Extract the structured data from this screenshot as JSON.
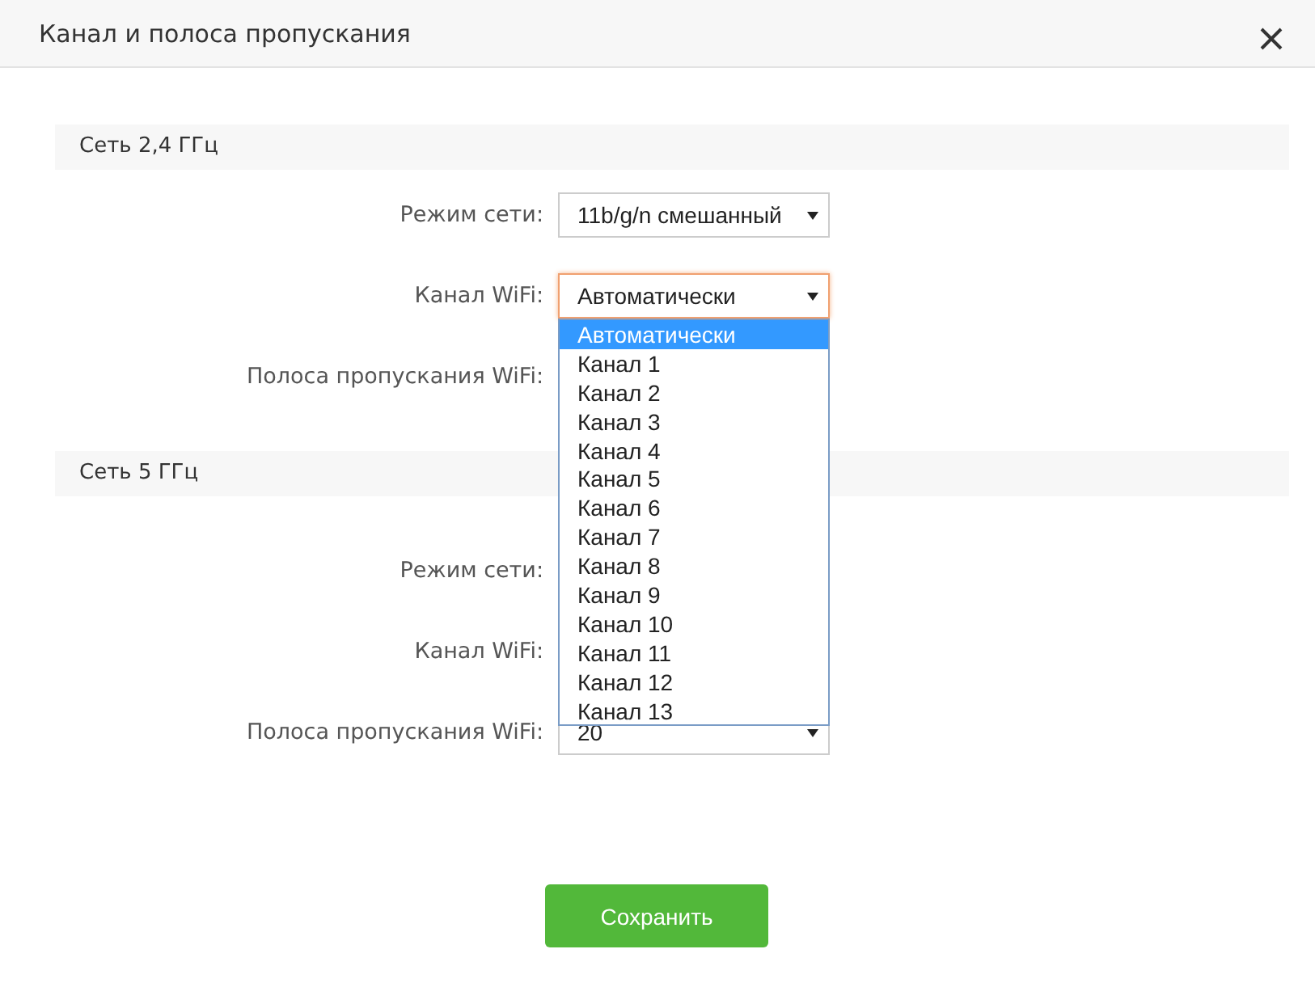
{
  "dialog": {
    "title": "Канал и полоса пропускания"
  },
  "sections": [
    {
      "title": "Сеть 2,4 ГГц",
      "fields": [
        {
          "label": "Режим сети:",
          "value": "11b/g/n смешанный",
          "focused": false
        },
        {
          "label": "Канал WiFi:",
          "value": "Автоматически",
          "focused": true,
          "dropdown": {
            "options": [
              {
                "label": "Автоматически",
                "selected": true
              },
              {
                "label": "Канал 1",
                "selected": false
              },
              {
                "label": "Канал 2",
                "selected": false
              },
              {
                "label": "Канал 3",
                "selected": false
              },
              {
                "label": "Канал 4",
                "selected": false
              },
              {
                "label": "Канал 5",
                "selected": false
              },
              {
                "label": "Канал 6",
                "selected": false
              },
              {
                "label": "Канал 7",
                "selected": false
              },
              {
                "label": "Канал 8",
                "selected": false
              },
              {
                "label": "Канал 9",
                "selected": false
              },
              {
                "label": "Канал 10",
                "selected": false
              },
              {
                "label": "Канал 11",
                "selected": false
              },
              {
                "label": "Канал 12",
                "selected": false
              },
              {
                "label": "Канал 13",
                "selected": false
              }
            ]
          }
        },
        {
          "label": "Полоса пропускания WiFi:"
        }
      ]
    },
    {
      "title": "Сеть 5 ГГц",
      "fields": [
        {
          "label": "Режим сети:"
        },
        {
          "label": "Канал WiFi:"
        },
        {
          "label": "Полоса пропускания WiFi:",
          "value": "20",
          "focused": false
        }
      ]
    }
  ],
  "save_button": "Сохранить"
}
